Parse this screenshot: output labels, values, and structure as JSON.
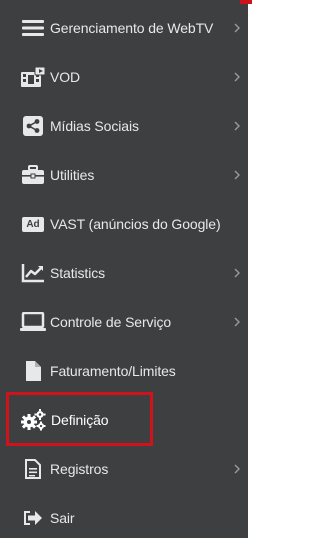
{
  "colors": {
    "sidebar_bg": "#3E3F41",
    "text": "#E8E8E8",
    "highlight": "#D0121C"
  },
  "menu": {
    "items": [
      {
        "label": "Gerenciamento de WebTV",
        "icon": "bars-icon",
        "has_submenu": true
      },
      {
        "label": "VOD",
        "icon": "film-icon",
        "has_submenu": true
      },
      {
        "label": "Mídias Sociais",
        "icon": "share-icon",
        "has_submenu": true
      },
      {
        "label": "Utilities",
        "icon": "briefcase-icon",
        "has_submenu": true
      },
      {
        "label": "VAST (anúncios do Google)",
        "icon": "ad-icon",
        "icon_text": "Ad",
        "has_submenu": false
      },
      {
        "label": "Statistics",
        "icon": "chart-icon",
        "has_submenu": true
      },
      {
        "label": "Controle de Serviço",
        "icon": "laptop-icon",
        "has_submenu": true
      },
      {
        "label": "Faturamento/Limites",
        "icon": "file-icon",
        "has_submenu": false
      },
      {
        "label": "Definição",
        "icon": "cogs-icon",
        "has_submenu": false,
        "highlighted": true
      },
      {
        "label": "Registros",
        "icon": "file-text-icon",
        "has_submenu": true
      },
      {
        "label": "Sair",
        "icon": "sign-out-icon",
        "has_submenu": false
      }
    ]
  }
}
